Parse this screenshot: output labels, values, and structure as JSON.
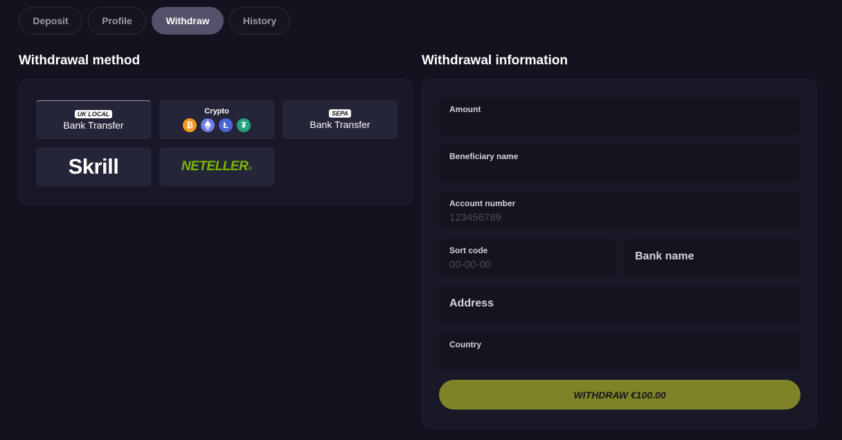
{
  "tabs": [
    {
      "label": "Deposit",
      "active": false
    },
    {
      "label": "Profile",
      "active": false
    },
    {
      "label": "Withdraw",
      "active": true
    },
    {
      "label": "History",
      "active": false
    }
  ],
  "left": {
    "title": "Withdrawal method",
    "methods": {
      "uk": {
        "badge": "UK LOCAL",
        "label": "Bank Transfer",
        "selected": true
      },
      "crypto": {
        "label": "Crypto",
        "coins": [
          "bitcoin-icon",
          "ethereum-icon",
          "litecoin-icon",
          "tether-icon"
        ]
      },
      "sepa": {
        "badge": "SEPA",
        "label": "Bank Transfer"
      },
      "skrill": {
        "logo": "Skrill"
      },
      "neteller": {
        "logo": "NETELLER",
        "mark": "®"
      }
    }
  },
  "right": {
    "title": "Withdrawal information",
    "fields": {
      "amount": {
        "label": "Amount"
      },
      "beneficiary": {
        "label": "Beneficiary name"
      },
      "account": {
        "label": "Account number",
        "placeholder": "123456789"
      },
      "sort": {
        "label": "Sort code",
        "placeholder": "00-00-00"
      },
      "bank": {
        "label": "Bank name"
      },
      "address": {
        "label": "Address"
      },
      "country": {
        "label": "Country"
      }
    },
    "button": "WITHDRAW €100.00"
  },
  "colors": {
    "background": "#13131f",
    "panel": "#181827",
    "tab_active": "#54526a",
    "button": "#7f8328",
    "neteller": "#7ab800"
  }
}
